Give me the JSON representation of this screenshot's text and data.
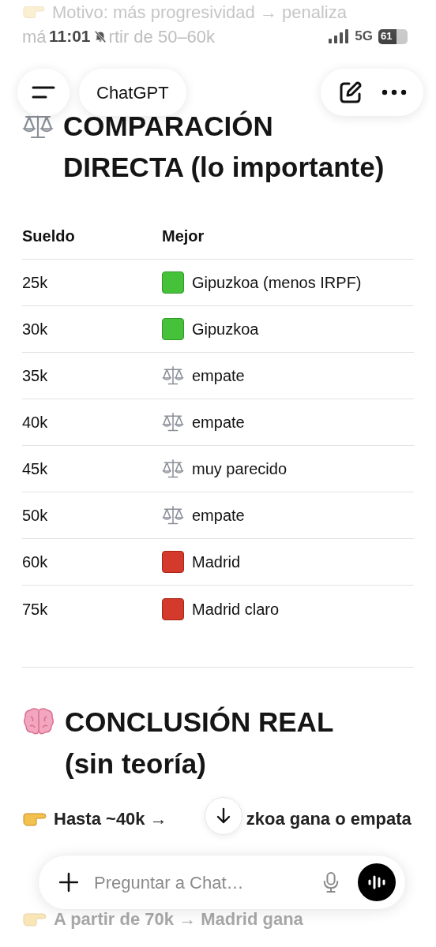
{
  "faded_top": {
    "line_1": "Motivo: más progresividad → penaliza",
    "line_2_start": "má",
    "line_2_end": "rtir de 50–60k"
  },
  "status_bar": {
    "time": "11:01",
    "network": "5G",
    "battery": "61"
  },
  "nav": {
    "title": "ChatGPT"
  },
  "comparison": {
    "title": "COMPARACIÓN DIRECTA (lo importante)"
  },
  "table": {
    "columns": [
      "Sueldo",
      "Mejor"
    ],
    "rows": [
      {
        "salary": "25k",
        "kind": "green",
        "result": "Gipuzkoa (menos IRPF)"
      },
      {
        "salary": "30k",
        "kind": "green",
        "result": "Gipuzkoa"
      },
      {
        "salary": "35k",
        "kind": "scale",
        "result": "empate"
      },
      {
        "salary": "40k",
        "kind": "scale",
        "result": "empate"
      },
      {
        "salary": "45k",
        "kind": "scale",
        "result": "muy parecido"
      },
      {
        "salary": "50k",
        "kind": "scale",
        "result": "empate"
      },
      {
        "salary": "60k",
        "kind": "red",
        "result": "Madrid"
      },
      {
        "salary": "75k",
        "kind": "red",
        "result": "Madrid claro"
      }
    ]
  },
  "conclusion": {
    "title": "CONCLUSIÓN REAL (sin teoría)",
    "points": [
      {
        "parts": [
          "Hasta ~40k →",
          "zkoa gana o empata"
        ],
        "faded": false
      },
      {
        "parts": [
          "A partir de 70k → Madrid gana"
        ],
        "faded": true
      }
    ]
  },
  "composer": {
    "placeholder": "Preguntar a Chat…"
  }
}
